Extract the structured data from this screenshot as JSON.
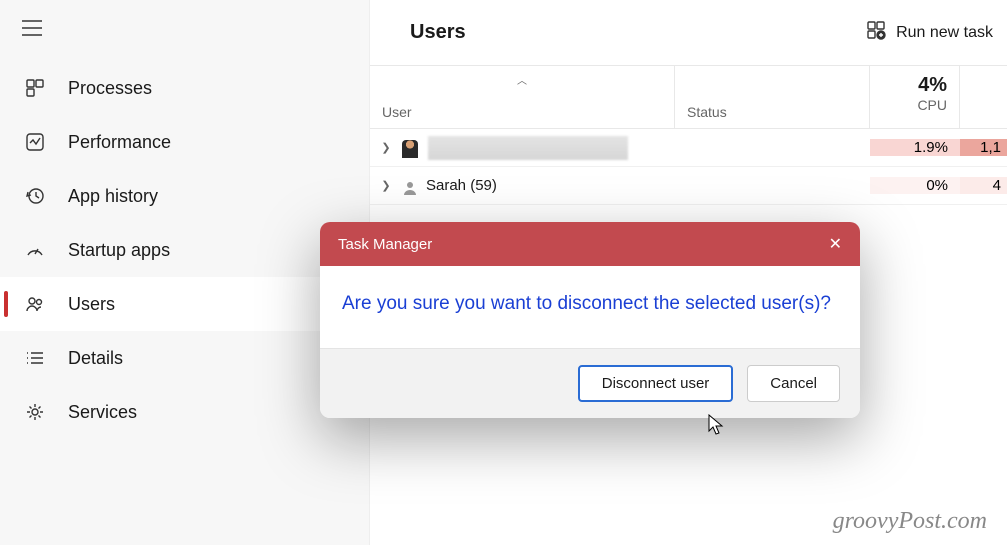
{
  "sidebar": {
    "items": [
      {
        "label": "Processes"
      },
      {
        "label": "Performance"
      },
      {
        "label": "App history"
      },
      {
        "label": "Startup apps"
      },
      {
        "label": "Users"
      },
      {
        "label": "Details"
      },
      {
        "label": "Services"
      }
    ]
  },
  "header": {
    "title": "Users",
    "run_task": "Run new task"
  },
  "table": {
    "cols": {
      "user": "User",
      "status": "Status",
      "cpu_pct": "4%",
      "cpu": "CPU"
    },
    "rows": [
      {
        "name": "",
        "cpu": "1.9%",
        "mem": "1,1"
      },
      {
        "name": "Sarah (59)",
        "cpu": "0%",
        "mem": "4"
      }
    ]
  },
  "dialog": {
    "title": "Task Manager",
    "message": "Are you sure you want to disconnect the selected user(s)?",
    "primary": "Disconnect user",
    "secondary": "Cancel"
  },
  "watermark": "groovyPost.com"
}
